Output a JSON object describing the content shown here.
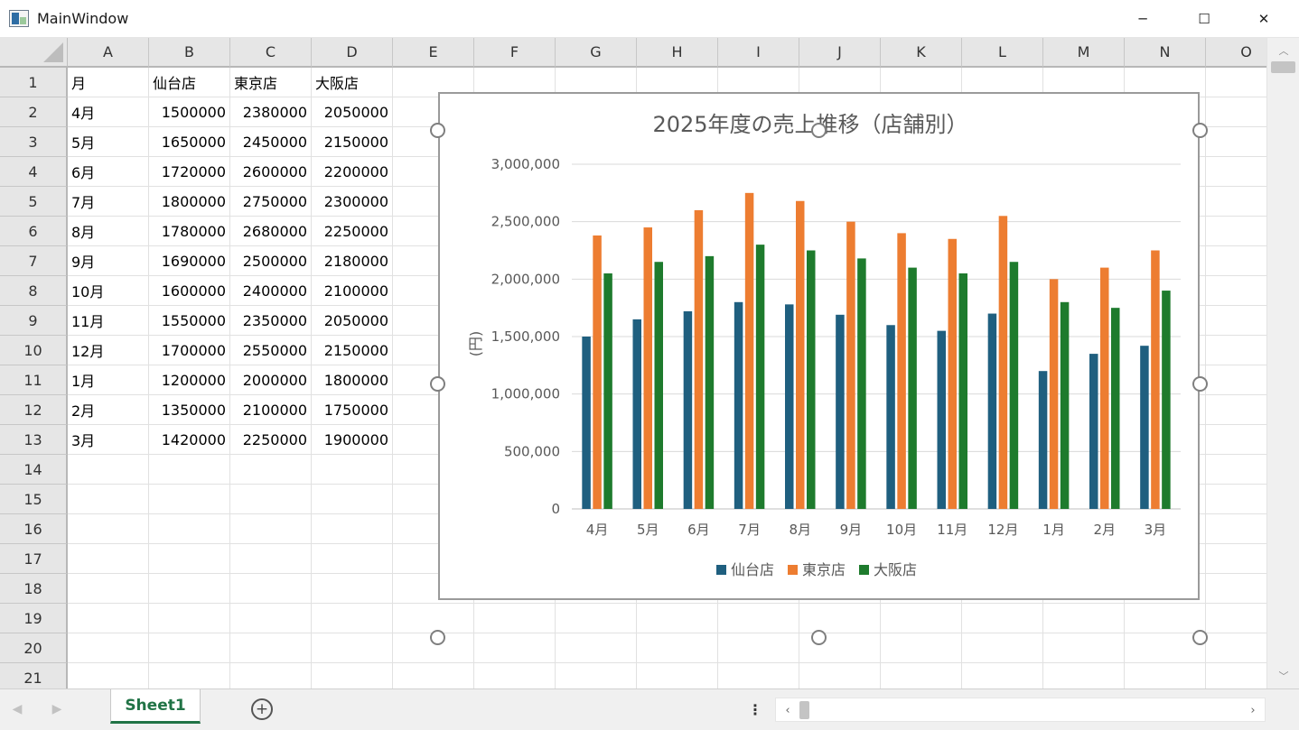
{
  "window": {
    "title": "MainWindow",
    "minimize_glyph": "─",
    "maximize_glyph": "☐",
    "close_glyph": "✕"
  },
  "sheet": {
    "columns": [
      "A",
      "B",
      "C",
      "D",
      "E",
      "F",
      "G",
      "H",
      "I",
      "J",
      "K",
      "L",
      "M",
      "N",
      "O"
    ],
    "rows": [
      "1",
      "2",
      "3",
      "4",
      "5",
      "6",
      "7",
      "8",
      "9",
      "10",
      "11",
      "12",
      "13",
      "14",
      "15",
      "16",
      "17",
      "18",
      "19",
      "20",
      "21"
    ],
    "cells": [
      [
        "月",
        "仙台店",
        "東京店",
        "大阪店"
      ],
      [
        "4月",
        "1500000",
        "2380000",
        "2050000"
      ],
      [
        "5月",
        "1650000",
        "2450000",
        "2150000"
      ],
      [
        "6月",
        "1720000",
        "2600000",
        "2200000"
      ],
      [
        "7月",
        "1800000",
        "2750000",
        "2300000"
      ],
      [
        "8月",
        "1780000",
        "2680000",
        "2250000"
      ],
      [
        "9月",
        "1690000",
        "2500000",
        "2180000"
      ],
      [
        "10月",
        "1600000",
        "2400000",
        "2100000"
      ],
      [
        "11月",
        "1550000",
        "2350000",
        "2050000"
      ],
      [
        "12月",
        "1700000",
        "2550000",
        "2150000"
      ],
      [
        "1月",
        "1200000",
        "2000000",
        "1800000"
      ],
      [
        "2月",
        "1350000",
        "2100000",
        "1750000"
      ],
      [
        "3月",
        "1420000",
        "2250000",
        "1900000"
      ]
    ]
  },
  "tabs": {
    "active_sheet": "Sheet1",
    "add_glyph": "+",
    "prev_glyph": "◀",
    "next_glyph": "▶",
    "split_glyph": "⋮"
  },
  "scrollbars": {
    "up_glyph": "︿",
    "down_glyph": "﹀",
    "left_glyph": "‹",
    "right_glyph": "›"
  },
  "colors": {
    "series": [
      "#1f5f7f",
      "#ed7d31",
      "#1e7b2d"
    ],
    "gridline": "#d9d9d9",
    "axis_text": "#595959",
    "tab_accent": "#217346"
  },
  "chart_data": {
    "type": "bar",
    "title": "2025年度の売上推移（店舗別）",
    "xlabel": "",
    "ylabel": "(円)",
    "ylim": [
      0,
      3000000
    ],
    "yticks": [
      0,
      500000,
      1000000,
      1500000,
      2000000,
      2500000,
      3000000
    ],
    "ytick_labels": [
      "0",
      "500,000",
      "1,000,000",
      "1,500,000",
      "2,000,000",
      "2,500,000",
      "3,000,000"
    ],
    "categories": [
      "4月",
      "5月",
      "6月",
      "7月",
      "8月",
      "9月",
      "10月",
      "11月",
      "12月",
      "1月",
      "2月",
      "3月"
    ],
    "series": [
      {
        "name": "仙台店",
        "values": [
          1500000,
          1650000,
          1720000,
          1800000,
          1780000,
          1690000,
          1600000,
          1550000,
          1700000,
          1200000,
          1350000,
          1420000
        ]
      },
      {
        "name": "東京店",
        "values": [
          2380000,
          2450000,
          2600000,
          2750000,
          2680000,
          2500000,
          2400000,
          2350000,
          2550000,
          2000000,
          2100000,
          2250000
        ]
      },
      {
        "name": "大阪店",
        "values": [
          2050000,
          2150000,
          2200000,
          2300000,
          2250000,
          2180000,
          2100000,
          2050000,
          2150000,
          1800000,
          1750000,
          1900000
        ]
      }
    ],
    "grid": true,
    "legend": "bottom"
  }
}
